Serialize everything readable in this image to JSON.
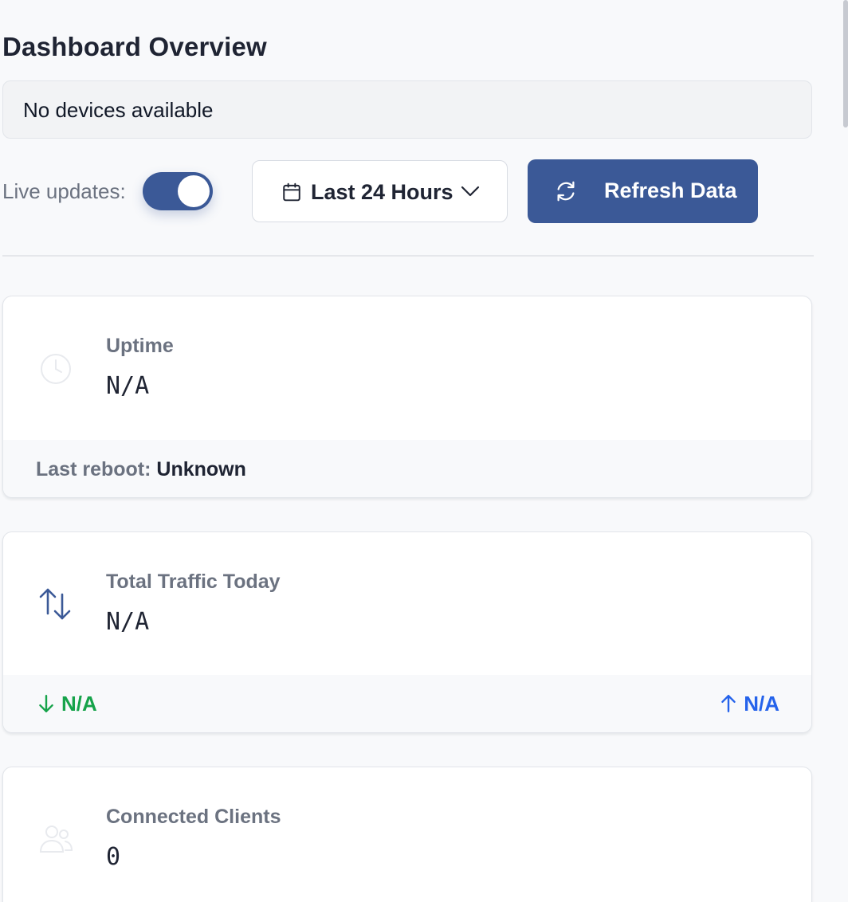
{
  "header": {
    "title": "Dashboard Overview"
  },
  "device_selector": {
    "value": "No devices available"
  },
  "controls": {
    "live_updates_label": "Live updates:",
    "live_updates_on": true,
    "time_range": "Last 24 Hours",
    "refresh_label": "Refresh Data"
  },
  "cards": {
    "uptime": {
      "label": "Uptime",
      "value": "N/A",
      "footer_key": "Last reboot:",
      "footer_value": "Unknown",
      "icon": "clock-icon"
    },
    "traffic": {
      "label": "Total Traffic Today",
      "value": "N/A",
      "download": "N/A",
      "upload": "N/A",
      "icon": "arrows-up-down-icon"
    },
    "clients": {
      "label": "Connected Clients",
      "value": "0",
      "icon": "users-icon"
    }
  },
  "colors": {
    "primary": "#3b5997",
    "download": "#16a34a",
    "upload": "#2563eb",
    "muted_text": "#6b7280"
  }
}
